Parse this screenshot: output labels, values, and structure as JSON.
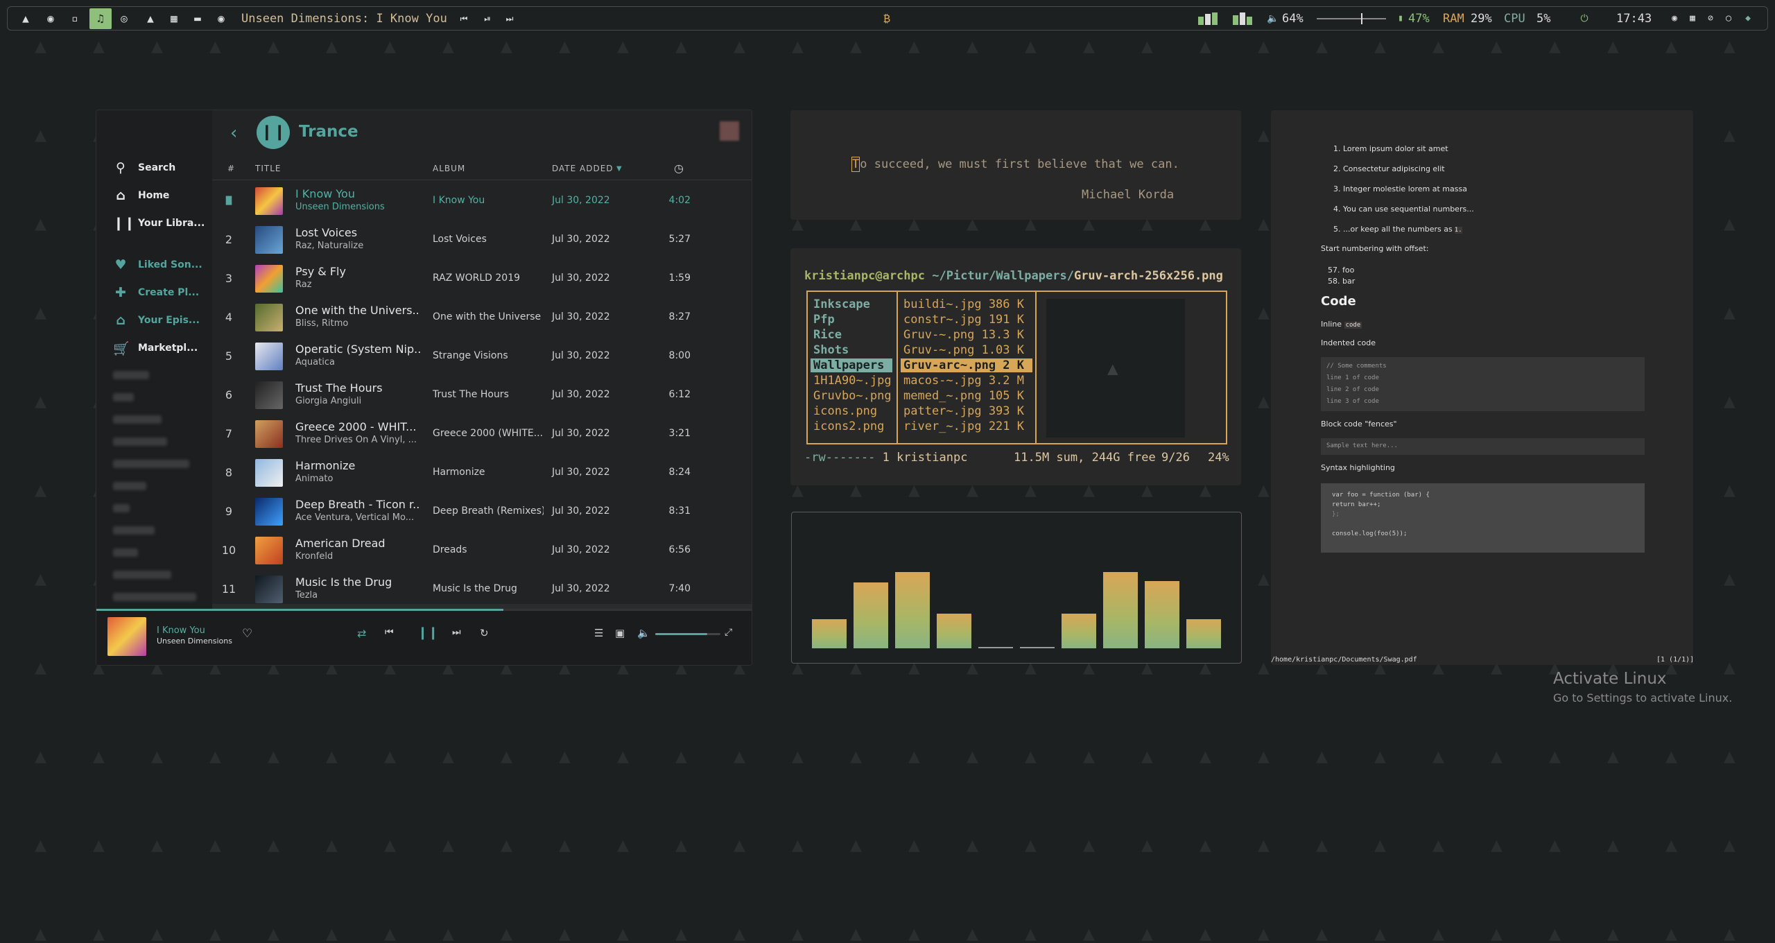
{
  "topbar": {
    "window_title": "Unseen Dimensions: I Know You",
    "volume": "64%",
    "battery": "47%",
    "ram_label": "RAM",
    "ram_value": "29%",
    "cpu_label": "CPU",
    "cpu_value": "5%",
    "clock": "17:43",
    "volume_level": 0.64
  },
  "spotify": {
    "playlist_title": "Trance",
    "nav": [
      {
        "label": "Search"
      },
      {
        "label": "Home"
      },
      {
        "label": "Your Libra..."
      },
      {
        "label": "Liked Son..."
      },
      {
        "label": "Create Pl..."
      },
      {
        "label": "Your Epis..."
      },
      {
        "label": "Marketpl..."
      }
    ],
    "columns": {
      "num": "#",
      "title": "TITLE",
      "album": "ALBUM",
      "date": "DATE ADDED"
    },
    "tracks": [
      {
        "num": "",
        "title": "I Know You",
        "artist": "Unseen Dimensions",
        "album": "I Know You",
        "date": "Jul 30, 2022",
        "duration": "4:02"
      },
      {
        "num": "2",
        "title": "Lost Voices",
        "artist": "Raz, Naturalize",
        "album": "Lost Voices",
        "date": "Jul 30, 2022",
        "duration": "5:27"
      },
      {
        "num": "3",
        "title": "Psy & Fly",
        "artist": "Raz",
        "album": "RAZ WORLD 2019",
        "date": "Jul 30, 2022",
        "duration": "1:59"
      },
      {
        "num": "4",
        "title": "One with the Univers...",
        "artist": "Bliss, Ritmo",
        "album": "One with the Universe",
        "date": "Jul 30, 2022",
        "duration": "8:27"
      },
      {
        "num": "5",
        "title": "Operatic (System Nip...",
        "artist": "Aquatica",
        "album": "Strange Visions",
        "date": "Jul 30, 2022",
        "duration": "8:00"
      },
      {
        "num": "6",
        "title": "Trust The Hours",
        "artist": "Giorgia Angiuli",
        "album": "Trust The Hours",
        "date": "Jul 30, 2022",
        "duration": "6:12"
      },
      {
        "num": "7",
        "title": "Greece 2000 - WHIT...",
        "artist": "Three Drives On A Vinyl, ...",
        "album": "Greece 2000 (WHITE...",
        "date": "Jul 30, 2022",
        "duration": "3:21"
      },
      {
        "num": "8",
        "title": "Harmonize",
        "artist": "Animato",
        "album": "Harmonize",
        "date": "Jul 30, 2022",
        "duration": "8:24"
      },
      {
        "num": "9",
        "title": "Deep Breath - Ticon r...",
        "artist": "Ace Ventura, Vertical Mo...",
        "album": "Deep Breath (Remixes)",
        "date": "Jul 30, 2022",
        "duration": "8:31"
      },
      {
        "num": "10",
        "title": "American Dread",
        "artist": "Kronfeld",
        "album": "Dreads",
        "date": "Jul 30, 2022",
        "duration": "6:56"
      },
      {
        "num": "11",
        "title": "Music Is the Drug",
        "artist": "Tezla",
        "album": "Music Is the Drug",
        "date": "Jul 30, 2022",
        "duration": "7:40"
      }
    ],
    "now_playing": {
      "title": "I Know You",
      "artist": "Unseen Dimensions",
      "progress": 0.62,
      "volume": 0.8
    }
  },
  "quote": {
    "first_char": "T",
    "text": "o succeed, we must first believe that we can.",
    "author": "Michael Korda"
  },
  "terminal": {
    "user_host": "kristianpc@archpc",
    "path": "~/Pictur/Wallpapers/",
    "file": "Gruv-arch-256x256.png",
    "col1": [
      "Inkscape",
      "Pfp",
      "Rice",
      "Shots",
      "Wallpapers",
      "1H1A90~.jpg",
      "Gruvbo~.png",
      "icons.png",
      "icons2.png"
    ],
    "col2": [
      "buildi~.jpg 386 K",
      "constr~.jpg 191 K",
      "Gruv-~.png 13.3 K",
      "Gruv-~.png 1.03 K",
      "Gruv-arc~.png 2 K",
      "macos-~.jpg 3.2 M",
      "memed_~.png 105 K",
      "patter~.jpg 393 K",
      "river_~.jpg 221 K"
    ],
    "status_perms": "-rw-------",
    "status_owner": "1 kristianpc",
    "status_sum": "11.5M sum, 244G free",
    "status_pos": "9/26",
    "status_pct": "24%"
  },
  "visualizer": {
    "levels": [
      0.38,
      0.86,
      1.0,
      0.45,
      0.02,
      0.02,
      0.45,
      1.0,
      0.88,
      0.38
    ]
  },
  "pdf": {
    "ordered": [
      "Lorem ipsum dolor sit amet",
      "Consectetur adipiscing elit",
      "Integer molestie lorem at massa",
      "You can use sequential numbers...",
      "...or keep all the numbers as"
    ],
    "ordered_code": "1.",
    "offset_label": "Start numbering with offset:",
    "offset_items": [
      "57. foo",
      "58. bar"
    ],
    "code_heading": "Code",
    "inline_label": "Inline",
    "inline_code": "code",
    "indented_label": "Indented code",
    "indented_lines": [
      "// Some comments",
      "line 1 of code",
      "line 2 of code",
      "line 3 of code"
    ],
    "fences_label": "Block code \"fences\"",
    "fences_text": "Sample text here...",
    "syntax_label": "Syntax highlighting",
    "syntax_lines": [
      "var foo = function (bar) {",
      "  return bar++;",
      "};",
      "",
      "console.log(foo(5));"
    ],
    "file_path": "/home/kristianpc/Documents/Swag.pdf",
    "page_indicator": "[1 (1/1)]"
  },
  "watermark": {
    "title": "Activate Linux",
    "subtitle": "Go to Settings to activate Linux."
  },
  "colors": {
    "accent": "#55a59e",
    "term_bg": "#282828",
    "term_yellow": "#d8a657",
    "term_blue": "#7daea3"
  }
}
